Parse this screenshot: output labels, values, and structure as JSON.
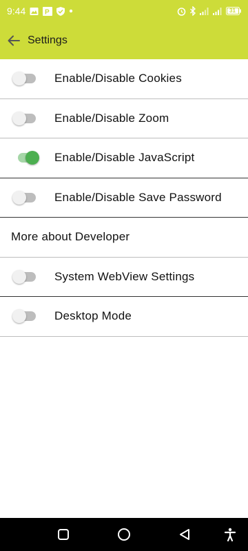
{
  "status_bar": {
    "time": "9:44",
    "battery": "31",
    "left_icons": [
      "image-icon",
      "parking-app-icon",
      "shield-icon",
      "dot-icon"
    ],
    "right_icons": [
      "alarm-icon",
      "bluetooth-icon",
      "signal-icon",
      "signal-icon",
      "battery-icon"
    ]
  },
  "app_bar": {
    "title": "Settings",
    "background": "#cddc39"
  },
  "settings": {
    "items": [
      {
        "label": "Enable/Disable Cookies",
        "toggle": true,
        "on": false
      },
      {
        "label": "Enable/Disable Zoom",
        "toggle": true,
        "on": false
      },
      {
        "label": "Enable/Disable JavaScript",
        "toggle": true,
        "on": true
      },
      {
        "label": "Enable/Disable Save Password",
        "toggle": true,
        "on": false
      },
      {
        "label": "More about Developer",
        "toggle": false
      },
      {
        "label": "System WebView Settings",
        "toggle": true,
        "on": false
      },
      {
        "label": "Desktop Mode",
        "toggle": true,
        "on": false
      }
    ]
  },
  "nav_bar": {
    "buttons": [
      "recents-icon",
      "home-icon",
      "back-icon",
      "accessibility-icon"
    ]
  },
  "colors": {
    "accent": "#4caf50",
    "toolbar": "#cddc39"
  }
}
